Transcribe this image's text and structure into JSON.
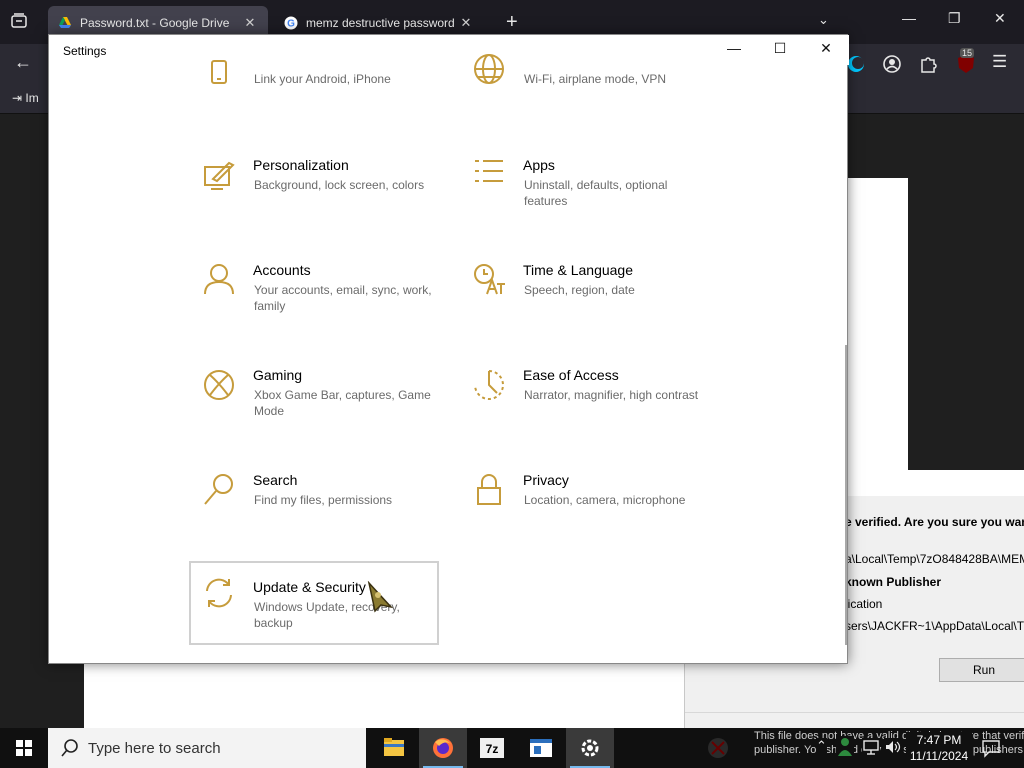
{
  "browser": {
    "tabs": [
      {
        "label": "Password.txt - Google Drive",
        "favicon": "google-drive-icon"
      },
      {
        "label": "memz destructive password - G",
        "favicon": "google-icon"
      }
    ],
    "new_tab": "+",
    "bookmark_item": "Im",
    "extension_badge": "15"
  },
  "settings": {
    "title": "Settings",
    "top_row": [
      {
        "desc": "Link your Android, iPhone",
        "icon": "phone-icon"
      },
      {
        "desc": "Wi-Fi, airplane mode, VPN",
        "icon": "globe-icon"
      }
    ],
    "tiles": [
      {
        "name": "Personalization",
        "desc": "Background, lock screen, colors",
        "icon": "personalization-icon"
      },
      {
        "name": "Apps",
        "desc": "Uninstall, defaults, optional features",
        "icon": "apps-icon"
      },
      {
        "name": "Accounts",
        "desc": "Your accounts, email, sync, work, family",
        "icon": "person-icon"
      },
      {
        "name": "Time & Language",
        "desc": "Speech, region, date",
        "icon": "time-language-icon"
      },
      {
        "name": "Gaming",
        "desc": "Xbox Game Bar, captures, Game Mode",
        "icon": "xbox-icon"
      },
      {
        "name": "Ease of Access",
        "desc": "Narrator, magnifier, high contrast",
        "icon": "ease-of-access-icon"
      },
      {
        "name": "Search",
        "desc": "Find my files, permissions",
        "icon": "search-icon"
      },
      {
        "name": "Privacy",
        "desc": "Location, camera, microphone",
        "icon": "lock-icon"
      },
      {
        "name": "Update & Security",
        "desc": "Windows Update, recovery, backup",
        "icon": "sync-icon"
      }
    ]
  },
  "security_dialog": {
    "line1": "e verified.  Are you sure you wan",
    "line2": "a\\Local\\Temp\\7zO848428BA\\MEM",
    "line3": "known Publisher",
    "line4": "lication",
    "line5": "sers\\JACKFR~1\\AppData\\Local\\T",
    "run_label": "Run",
    "footer_text1": "This file does not have a valid digital signature that verifies its",
    "footer_text2": "publisher. You should only run software from publishers you trust."
  },
  "taskbar": {
    "search_placeholder": "Type here to search",
    "time": "7:47 PM",
    "date": "11/11/2024"
  },
  "colors": {
    "accent_icon": "#c69c3c",
    "taskbar": "#101010",
    "active_underline": "#76b9ed"
  }
}
